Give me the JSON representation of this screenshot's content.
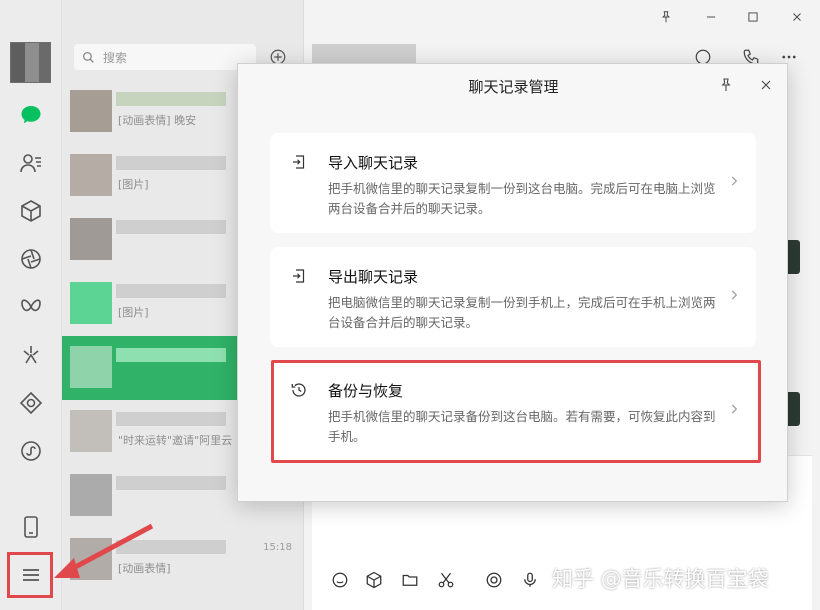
{
  "window": {
    "pin_icon": "pin-icon",
    "minimize_icon": "minimize-icon",
    "maximize_icon": "maximize-icon",
    "close_icon": "close-icon"
  },
  "nav": {
    "items": [
      {
        "name": "chats",
        "icon": "chat-bubble-icon",
        "active": true
      },
      {
        "name": "contacts",
        "icon": "contacts-icon"
      },
      {
        "name": "favorites",
        "icon": "cube-icon"
      },
      {
        "name": "moments",
        "icon": "aperture-icon"
      },
      {
        "name": "channels",
        "icon": "butterfly-icon"
      },
      {
        "name": "top-stories",
        "icon": "sparkle-icon"
      },
      {
        "name": "search",
        "icon": "diamond-icon"
      },
      {
        "name": "mini-programs",
        "icon": "mini-program-icon"
      },
      {
        "name": "phone",
        "icon": "phone-icon"
      },
      {
        "name": "menu",
        "icon": "hamburger-menu-icon"
      }
    ],
    "accent": "#07c160"
  },
  "search": {
    "placeholder": "搜索"
  },
  "chats": [
    {
      "preview": "[动画表情] 晚安",
      "time": ""
    },
    {
      "preview": "[图片]",
      "time": ""
    },
    {
      "preview": "",
      "time": ""
    },
    {
      "preview": "[图片]",
      "time": ""
    },
    {
      "preview": "",
      "time": "",
      "active": true
    },
    {
      "preview": "\"时来运转\"邀请\"阿里云",
      "time": ""
    },
    {
      "preview": "",
      "time": ""
    },
    {
      "preview": "[动画表情]",
      "time": "15:18"
    }
  ],
  "modal": {
    "title": "聊天记录管理",
    "cards": [
      {
        "icon": "import-icon",
        "title": "导入聊天记录",
        "desc": "把手机微信里的聊天记录复制一份到这台电脑。完成后可在电脑上浏览两台设备合并后的聊天记录。"
      },
      {
        "icon": "export-icon",
        "title": "导出聊天记录",
        "desc": "把电脑微信里的聊天记录复制一份到手机上，完成后可在手机上浏览两台设备合并后的聊天记录。"
      },
      {
        "icon": "history-icon",
        "title": "备份与恢复",
        "desc": "把手机微信里的聊天记录备份到这台电脑。若有需要，可恢复此内容到手机。"
      }
    ],
    "highlight_color": "#e0484b"
  },
  "watermark": "知乎 @音乐转换百宝袋"
}
